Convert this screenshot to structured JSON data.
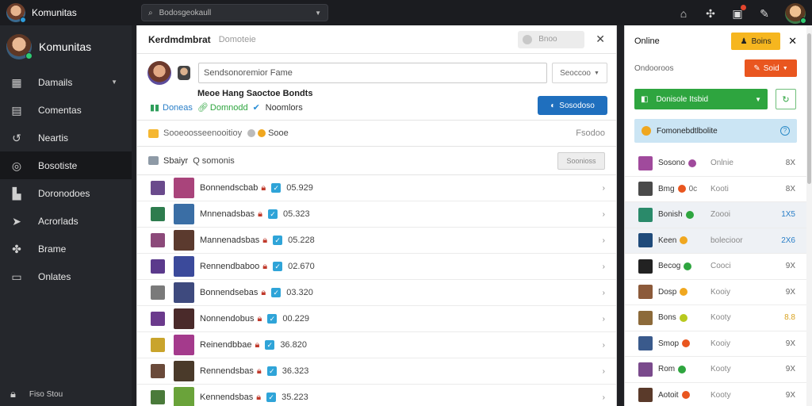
{
  "topbar": {
    "brand": "Komunitas",
    "search_placeholder": "Bodosgeokaull",
    "icons": [
      "home-icon",
      "puzzle-icon",
      "gift-icon",
      "edit-icon"
    ]
  },
  "sidebar": {
    "title": "Komunitas",
    "items": [
      {
        "label": "Damails",
        "icon": "grid-icon",
        "caret": "▾"
      },
      {
        "label": "Comentas",
        "icon": "clipboard-icon"
      },
      {
        "label": "Neartis",
        "icon": "back-arrow-icon"
      },
      {
        "label": "Bosotiste",
        "icon": "compass-icon"
      },
      {
        "label": "Doronodoes",
        "icon": "bar-chart-icon"
      },
      {
        "label": "Acrorlads",
        "icon": "send-icon"
      },
      {
        "label": "Brame",
        "icon": "puzzle-icon"
      },
      {
        "label": "Onlates",
        "icon": "chat-icon"
      }
    ],
    "footer": "Fiso Stou"
  },
  "main": {
    "title": "Kerdmdmbrat",
    "subtitle": "Domoteie",
    "pill_text": "Bnoo",
    "composer": {
      "input_placeholder": "Sendsonoremior Fame",
      "select_label": "Seoccoo",
      "post_title": "Meoe Hang Saoctoe Bondts",
      "options": [
        {
          "label": "Doneas",
          "icon": "chart-icon",
          "color": "#2e9e5a"
        },
        {
          "label": "Domnodd",
          "icon": "link-icon",
          "color": "#2ea53f"
        },
        {
          "label": "Noomlors",
          "icon": "check-shield-icon",
          "color": "#2a8fd6"
        }
      ],
      "button": "Sosodoso"
    },
    "info_row": {
      "text": "Sooeoosseenooitioy",
      "badge": "Sooe",
      "right": "Fsodoo"
    },
    "filter_row": {
      "label": "Sbaiyr",
      "query": "Q somonis",
      "button": "Soonioss"
    },
    "rows": [
      {
        "name": "Bonnendscbab",
        "value": "05.929",
        "c1": "#6a4a8c",
        "c2": "#a9447b"
      },
      {
        "name": "Mnnenadsbas",
        "value": "05.323",
        "c1": "#2e7c4e",
        "c2": "#3a6ea5"
      },
      {
        "name": "Mannenadsbas",
        "value": "05.228",
        "c1": "#8c4a7a",
        "c2": "#5b3a2e"
      },
      {
        "name": "Rennendbaboo",
        "value": "02.670",
        "c1": "#5b3a8c",
        "c2": "#3b4a9b"
      },
      {
        "name": "Bonnendsebas",
        "value": "03.320",
        "c1": "#7a7a7a",
        "c2": "#3e4a7e"
      },
      {
        "name": "Nonnendobus",
        "value": "00.229",
        "c1": "#6b3a8c",
        "c2": "#4a2a2a"
      },
      {
        "name": "Reinendbbae",
        "value": "36.820",
        "c1": "#c9a42c",
        "c2": "#a43a8c"
      },
      {
        "name": "Rennendsbas",
        "value": "36.323",
        "c1": "#6a4a3a",
        "c2": "#4a3a2a"
      },
      {
        "name": "Kennendsbas",
        "value": "35.223",
        "c1": "#4a7a3a",
        "c2": "#6aa33a"
      }
    ]
  },
  "right": {
    "title": "Online",
    "head_button": "Boins",
    "subtitle": "Ondooroos",
    "sub_button": "Soid",
    "green_button": "Donisole Itsbid",
    "blue_banner": "Fomonebdtlbolite",
    "users": [
      {
        "name": "Sosono",
        "status": "Onlnie",
        "num": "8X",
        "color": "#a04a9c",
        "dot": "#a04a9c",
        "extra": ""
      },
      {
        "name": "Bmg",
        "status": "Kooti",
        "num": "8X",
        "color": "#4a4a4a",
        "dot": "#e9561f",
        "extra": "0c"
      },
      {
        "name": "Bonish",
        "status": "Zoooi",
        "num": "1X5",
        "color": "#2a8a6a",
        "dot": "#2ea53f",
        "extra": "",
        "hl": true,
        "numColor": "#2a7fc8"
      },
      {
        "name": "Keen",
        "status": "bolecioor",
        "num": "2X6",
        "color": "#1f4a7a",
        "dot": "#f0a71f",
        "extra": "",
        "hl": true,
        "numColor": "#2a7fc8"
      },
      {
        "name": "Becog",
        "status": "Cooci",
        "num": "9X",
        "color": "#222",
        "dot": "#2ea53f",
        "extra": ""
      },
      {
        "name": "Dosp",
        "status": "Kooiy",
        "num": "9X",
        "color": "#8c5a3a",
        "dot": "#f0a71f",
        "extra": ""
      },
      {
        "name": "Bons",
        "status": "Kooty",
        "num": "8.8",
        "color": "#8c6a3a",
        "dot": "#b8c91f",
        "extra": "",
        "numColor": "#d9a21f"
      },
      {
        "name": "Smop",
        "status": "Kooiy",
        "num": "9X",
        "color": "#3a5a8c",
        "dot": "#e9561f",
        "extra": ""
      },
      {
        "name": "Rom",
        "status": "Kooty",
        "num": "9X",
        "color": "#7a4a8c",
        "dot": "#2ea53f",
        "extra": ""
      },
      {
        "name": "Aotoit",
        "status": "Kooty",
        "num": "9X",
        "color": "#5a3a2a",
        "dot": "#e9561f",
        "extra": ""
      }
    ]
  }
}
